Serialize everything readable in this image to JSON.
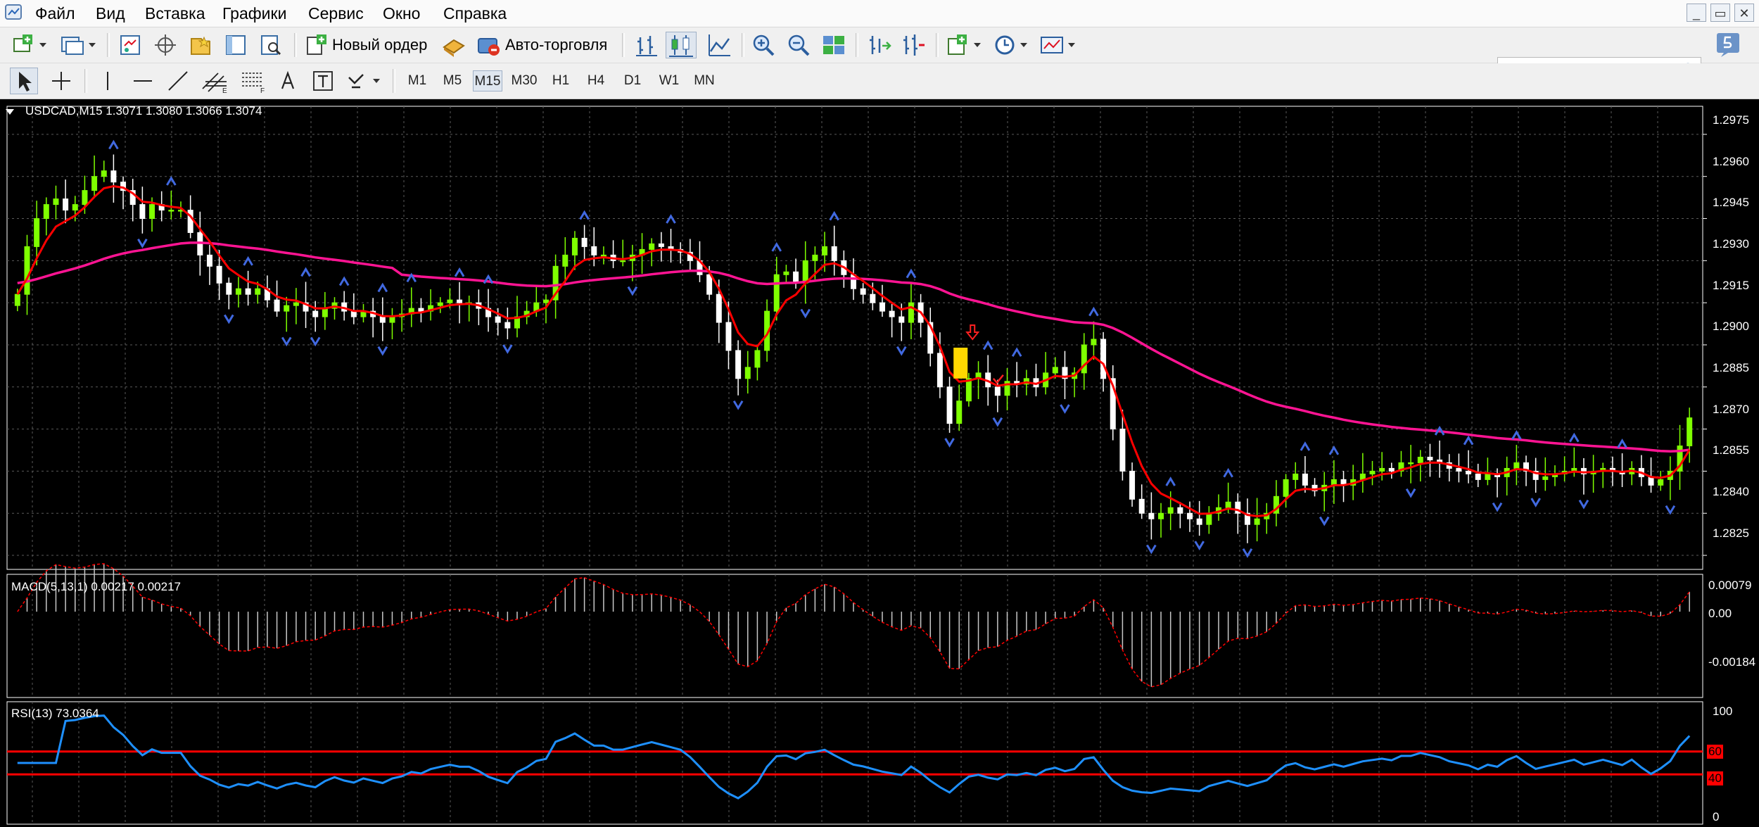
{
  "menu": [
    "Файл",
    "Вид",
    "Вставка",
    "Графики",
    "Сервис",
    "Окно",
    "Справка"
  ],
  "window_buttons": [
    "_",
    "▭",
    "✕"
  ],
  "toolbar": {
    "new_order_label": "Новый ордер",
    "auto_trading_label": "Авто-торговля"
  },
  "search": {
    "value": "",
    "placeholder": ""
  },
  "timeframes": [
    "M1",
    "M5",
    "M15",
    "M30",
    "H1",
    "H4",
    "D1",
    "W1",
    "MN"
  ],
  "active_timeframe": "M15",
  "main_chart": {
    "header": "USDCAD,M15  1.3071 1.3080 1.3066 1.3074",
    "y_ticks": [
      "1.2975",
      "1.2960",
      "1.2945",
      "1.2930",
      "1.2915",
      "1.2900",
      "1.2885",
      "1.2870",
      "1.2855",
      "1.2840",
      "1.2825"
    ]
  },
  "macd": {
    "header": "MACD(5,13,1) 0.00217 0.00217",
    "y_ticks": [
      "0.00079",
      "0.00",
      "-0.00184"
    ]
  },
  "rsi": {
    "header": "RSI(13) 73.0364",
    "y_ticks": [
      "100",
      "0"
    ],
    "levels": [
      "60",
      "40"
    ]
  },
  "colors": {
    "background": "#000000",
    "bull_candle": "#7fff00",
    "bear_candle": "#ffffff",
    "fast_ma": "#ff0000",
    "slow_ma": "#ff1493",
    "macd_line": "#ff0000",
    "rsi_line": "#1e90ff",
    "level_line": "#ff0000",
    "fractal": "#4169e1",
    "signal_box": "#ffd700"
  },
  "chart_data": {
    "type": "candlestick",
    "symbol": "USDCAD",
    "timeframe": "M15",
    "ylim": [
      1.282,
      1.2985
    ],
    "close": [
      1.2918,
      1.2935,
      1.2945,
      1.295,
      1.2952,
      1.2948,
      1.295,
      1.2955,
      1.296,
      1.2962,
      1.2958,
      1.2955,
      1.295,
      1.2945,
      1.295,
      1.2948,
      1.2948,
      1.2948,
      1.294,
      1.2932,
      1.2928,
      1.2922,
      1.2918,
      1.292,
      1.2918,
      1.292,
      1.2916,
      1.2912,
      1.2914,
      1.2915,
      1.2912,
      1.291,
      1.2913,
      1.2915,
      1.2912,
      1.291,
      1.2912,
      1.291,
      1.2908,
      1.291,
      1.2911,
      1.2913,
      1.2912,
      1.2914,
      1.2915,
      1.2916,
      1.2915,
      1.2915,
      1.2913,
      1.291,
      1.2908,
      1.2906,
      1.291,
      1.2912,
      1.2915,
      1.2916,
      1.2928,
      1.2932,
      1.2938,
      1.2935,
      1.2932,
      1.2932,
      1.293,
      1.293,
      1.2932,
      1.2934,
      1.2936,
      1.2935,
      1.2934,
      1.2933,
      1.293,
      1.2925,
      1.2918,
      1.2908,
      1.2898,
      1.2888,
      1.2892,
      1.2898,
      1.2912,
      1.2925,
      1.2926,
      1.2922,
      1.293,
      1.2932,
      1.2935,
      1.293,
      1.2925,
      1.292,
      1.2918,
      1.2915,
      1.2912,
      1.291,
      1.2908,
      1.2915,
      1.2908,
      1.2897,
      1.2885,
      1.2872,
      1.288,
      1.2888,
      1.289,
      1.2885,
      1.2882,
      1.2887,
      1.2886,
      1.2888,
      1.2885,
      1.289,
      1.2892,
      1.2888,
      1.289,
      1.29,
      1.2902,
      1.2888,
      1.287,
      1.2855,
      1.2845,
      1.284,
      1.2838,
      1.284,
      1.2842,
      1.284,
      1.2838,
      1.2836,
      1.284,
      1.2842,
      1.2844,
      1.284,
      1.2836,
      1.2838,
      1.284,
      1.2846,
      1.2852,
      1.2854,
      1.285,
      1.2848,
      1.285,
      1.2852,
      1.285,
      1.2852,
      1.2854,
      1.2855,
      1.2856,
      1.2855,
      1.2858,
      1.2858,
      1.286,
      1.2859,
      1.2858,
      1.2856,
      1.2855,
      1.2854,
      1.2852,
      1.2854,
      1.2853,
      1.2856,
      1.2858,
      1.2855,
      1.2852,
      1.2853,
      1.2854,
      1.2855,
      1.2856,
      1.2854,
      1.2855,
      1.2856,
      1.2855,
      1.2854,
      1.2856,
      1.2853,
      1.285,
      1.2852,
      1.2855,
      1.2864,
      1.2874
    ]
  }
}
